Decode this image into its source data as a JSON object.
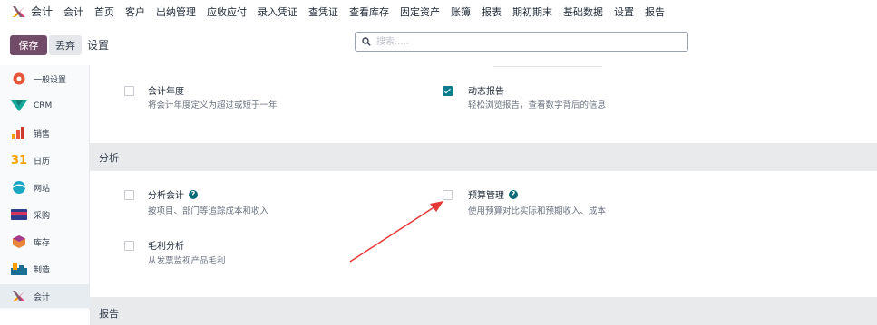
{
  "topnav": {
    "app_name": "会计",
    "menu": [
      "会计",
      "首页",
      "客户",
      "出纳管理",
      "应收应付",
      "录入凭证",
      "查凭证",
      "查看库存",
      "固定资产",
      "账簿",
      "报表",
      "期初期末",
      "基础数据",
      "设置",
      "报告"
    ]
  },
  "controls": {
    "save_label": "保存",
    "discard_label": "丢弃",
    "breadcrumb": "设置",
    "search_placeholder": "搜索....."
  },
  "sidebar": {
    "items": [
      {
        "label": "一般设置",
        "icon": "general-settings-icon"
      },
      {
        "label": "CRM",
        "icon": "crm-icon"
      },
      {
        "label": "销售",
        "icon": "sales-icon"
      },
      {
        "label": "日历",
        "icon": "calendar-icon",
        "icon_text": "31"
      },
      {
        "label": "网站",
        "icon": "website-icon"
      },
      {
        "label": "采购",
        "icon": "purchase-icon"
      },
      {
        "label": "库存",
        "icon": "inventory-icon"
      },
      {
        "label": "制造",
        "icon": "manufacturing-icon"
      },
      {
        "label": "会计",
        "icon": "accounting-icon"
      }
    ],
    "active": "会计"
  },
  "settings_top": [
    {
      "title": "会计年度",
      "desc": "将会计年度定义为超过或短于一年",
      "checked": false
    },
    {
      "title": "动态报告",
      "desc": "轻松浏览报告，查看数字背后的信息",
      "checked": true
    }
  ],
  "sections": {
    "analysis_title": "分析",
    "report_title": "报告"
  },
  "settings_analysis": [
    {
      "title": "分析会计",
      "desc": "按项目、部门等追踪成本和收入",
      "checked": false,
      "help": true
    },
    {
      "title": "预算管理",
      "desc": "使用预算对比实际和预期收入、成本",
      "checked": false,
      "help": true
    },
    {
      "title": "毛利分析",
      "desc": "从发票监视产品毛利",
      "checked": false,
      "help": false
    }
  ],
  "colors": {
    "brand": "#714b67",
    "checkbox_checked": "#0b7d8d",
    "annotation_arrow": "#e53935"
  }
}
